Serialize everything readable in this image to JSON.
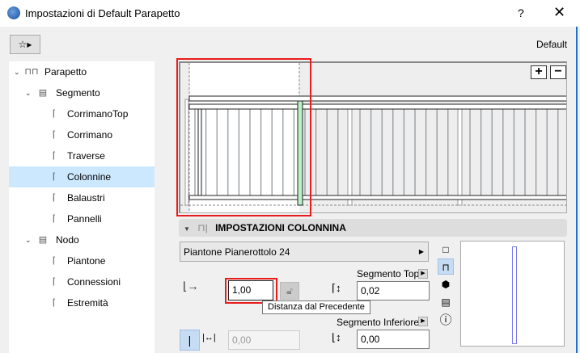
{
  "window": {
    "title": "Impostazioni di Default Parapetto",
    "help": "?",
    "close": "✕"
  },
  "toolbar": {
    "favorites_icon": "☆▸",
    "default_label": "Default"
  },
  "tree": [
    {
      "label": "Parapetto",
      "level": 0,
      "expanded": true
    },
    {
      "label": "Segmento",
      "level": 1,
      "expanded": true
    },
    {
      "label": "CorrimanoTop",
      "level": 2
    },
    {
      "label": "Corrimano",
      "level": 2
    },
    {
      "label": "Traverse",
      "level": 2
    },
    {
      "label": "Colonnine",
      "level": 2,
      "selected": true
    },
    {
      "label": "Balaustri",
      "level": 2
    },
    {
      "label": "Pannelli",
      "level": 2
    },
    {
      "label": "Nodo",
      "level": 1,
      "expanded": true
    },
    {
      "label": "Piantone",
      "level": 2
    },
    {
      "label": "Connessioni",
      "level": 2
    },
    {
      "label": "Estremità",
      "level": 2
    }
  ],
  "preview": {
    "zoom_in": "+",
    "zoom_out": "−"
  },
  "section": {
    "title": "IMPOSTAZIONI COLONNINA"
  },
  "settings": {
    "profile": "Piantone Pianerottolo 24",
    "distance_value": "1,00",
    "distance_tooltip": "Distanza dal Precedente",
    "spacing_value": "0,00",
    "top_ref_label": "Segmento Top",
    "top_offset": "0,02",
    "bottom_ref_label": "Segmento Inferiore",
    "bottom_offset": "0,00"
  },
  "colors": {
    "accent": "#e81c1c",
    "selected": "#cce8ff",
    "highlight_post": "#b9f0c6"
  }
}
